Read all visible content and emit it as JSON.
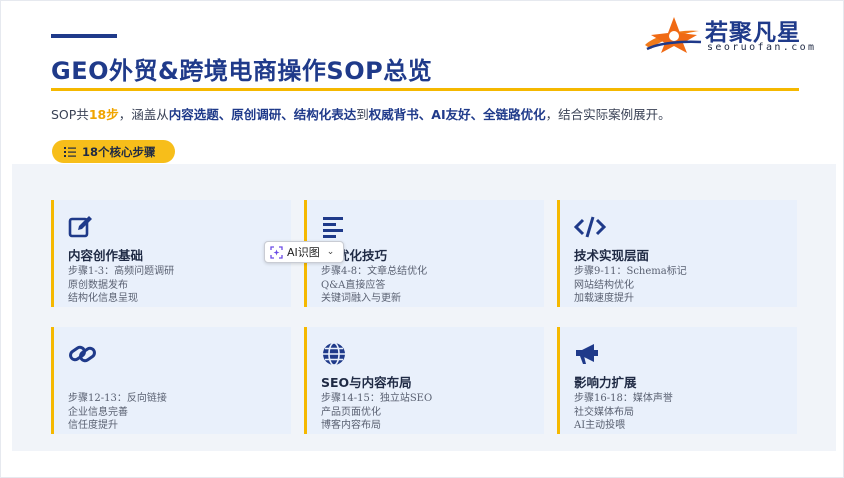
{
  "header": {
    "title": "GEO外贸&跨境电商操作SOP总览"
  },
  "logo": {
    "cn": "若聚凡星",
    "en": "seoruofan.com"
  },
  "intro": {
    "p1": "SOP共",
    "steps": "18步",
    "p2": "，涵盖从",
    "k1": "内容选题、原创调研、结构化表达",
    "p3": "到",
    "k2": "权威背书、AI友好、全链路优化",
    "p4": "，结合实际案例展开。"
  },
  "pill": {
    "icon": "list-ordered-icon",
    "label": "18个核心步骤"
  },
  "cards": [
    {
      "icon": "edit-icon",
      "title": "内容创作基础",
      "lines": [
        "步骤1-3：高频问题调研",
        "原创数据发布",
        "结构化信息呈现"
      ]
    },
    {
      "icon": "align-left-icon",
      "title": "优化技巧",
      "lines": [
        "步骤4-8：文章总结优化",
        "Q&A直接应答",
        "关键词融入与更新"
      ]
    },
    {
      "icon": "code-icon",
      "title": "技术实现层面",
      "lines": [
        "步骤9-11：Schema标记",
        "网站结构优化",
        "加载速度提升"
      ]
    },
    {
      "icon": "link-icon",
      "title": "",
      "lines": [
        "步骤12-13：反向链接",
        "企业信息完善",
        "信任度提升"
      ]
    },
    {
      "icon": "globe-icon",
      "title": "SEO与内容布局",
      "lines": [
        "步骤14-15：独立站SEO",
        "产品页面优化",
        "博客内容布局"
      ]
    },
    {
      "icon": "megaphone-icon",
      "title": "影响力扩展",
      "lines": [
        "步骤16-18：媒体声誉",
        "社交媒体布局",
        "AI主动投喂"
      ]
    }
  ],
  "ai_popup": {
    "label": "AI识图",
    "icon": "ai-scan-icon"
  },
  "colors": {
    "primary": "#1f3a8a",
    "accent": "#f5b800",
    "orange": "#f0a500",
    "card_bg": "#e9f0fb",
    "panel_bg": "#f1f4f9"
  }
}
